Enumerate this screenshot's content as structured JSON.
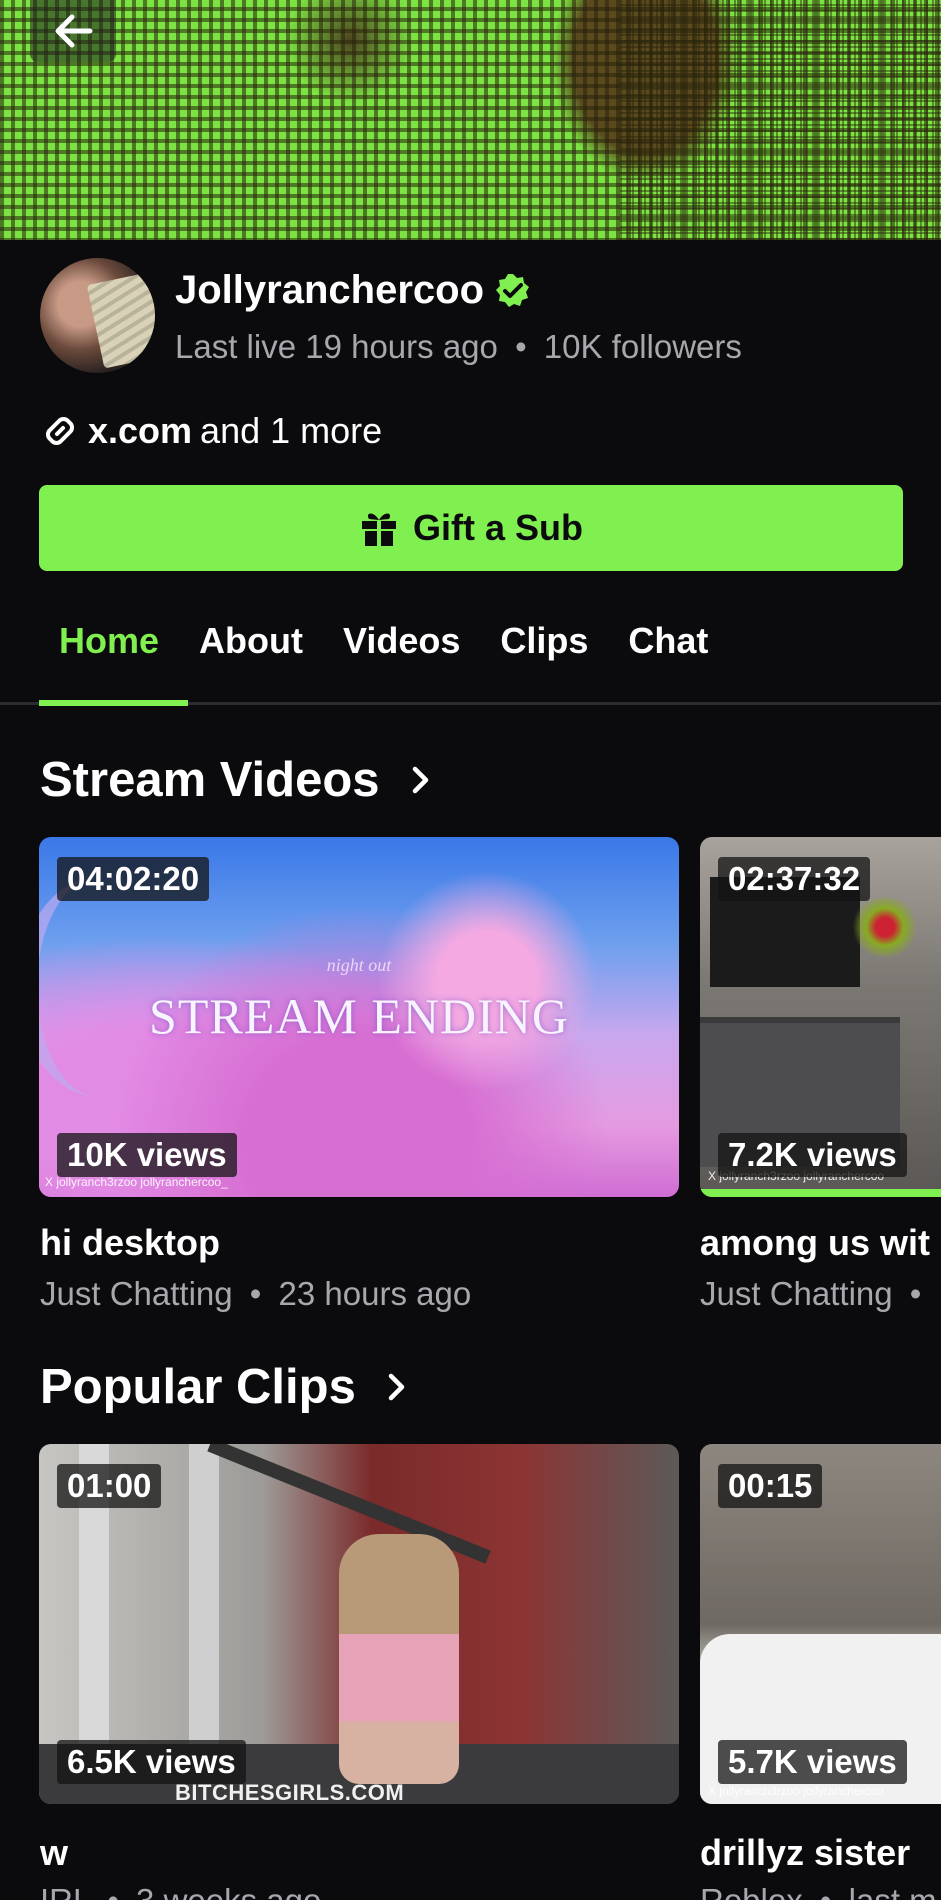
{
  "banner": {
    "back_label": "Back"
  },
  "profile": {
    "username": "Jollyranchercoo",
    "verified": true,
    "last_live": "Last live 19 hours ago",
    "separator": "•",
    "followers": "10K followers",
    "links_primary": "x.com",
    "links_more": "and 1 more"
  },
  "actions": {
    "gift_sub": "Gift a Sub"
  },
  "tabs": [
    {
      "label": "Home",
      "active": true
    },
    {
      "label": "About",
      "active": false
    },
    {
      "label": "Videos",
      "active": false
    },
    {
      "label": "Clips",
      "active": false
    },
    {
      "label": "Chat",
      "active": false
    }
  ],
  "stream_videos": {
    "title": "Stream Videos",
    "items": [
      {
        "duration": "04:02:20",
        "views": "10K views",
        "title": "hi desktop",
        "category": "Just Chatting",
        "age": "23 hours ago",
        "thumb_text": "STREAM ENDING",
        "thumb_subtext": "night out",
        "thumb_handles": "X jollyranch3rzoo  jollyranchercoo_"
      },
      {
        "duration": "02:37:32",
        "views": "7.2K views",
        "title": "among us wit",
        "category": "Just Chatting",
        "age": "",
        "thumb_handles": "X jollyranch3rzoo  jollyranchercoo"
      }
    ]
  },
  "popular_clips": {
    "title": "Popular Clips",
    "items": [
      {
        "duration": "01:00",
        "views": "6.5K views",
        "title": "w",
        "category": "IRL",
        "age": "3 weeks ago"
      },
      {
        "duration": "00:15",
        "views": "5.7K views",
        "title": "drillyz sister",
        "category": "Roblox",
        "age": "last m",
        "thumb_handles": "X jollyranch3rzoo  jollyranchercoo"
      }
    ]
  },
  "watermark": "BITCHESGIRLS.COM",
  "colors": {
    "accent": "#80f050",
    "background": "#0b0b0d",
    "muted": "#a7a7ad"
  }
}
